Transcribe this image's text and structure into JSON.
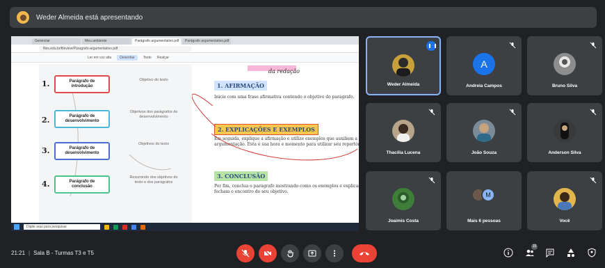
{
  "presenter_banner": {
    "text": "Weder Almeida está apresentando"
  },
  "shared_screen": {
    "browser_tabs": [
      "Gerenciar",
      "Meu ambiente",
      "Parágrafo argumentativo.pdf",
      "Parágrafo argumentativo.pdf"
    ],
    "url": "files.edu.br/fileview/Paragrafo-argumentativo.pdf",
    "toolbar": {
      "draw": "Desenhar",
      "read": "Ler em voz alta",
      "text": "Texto",
      "highlight": "Realçar"
    },
    "mind_map": [
      {
        "num": "1.",
        "label": "Parágrafo de introdução",
        "note": "Objetivo do texto",
        "color": "#e04a4a"
      },
      {
        "num": "2.",
        "label": "Parágrafo de desenvolvimento",
        "note": "Objetivos dos parágrafos de desenvolvimento",
        "color": "#4ab8d8"
      },
      {
        "num": "3.",
        "label": "Parágrafo de desenvolvimento",
        "note": "Objetivos do texto",
        "color": "#4a6ed8"
      },
      {
        "num": "4.",
        "label": "Parágrafo de conclusão",
        "note": "Resumindo dos objetivos do texto e dos parágrafos",
        "color": "#4ac48a"
      }
    ],
    "handwriting": "da redação",
    "sections": [
      {
        "title": "1. AFIRMAÇÃO",
        "body": "Inicie com uma frase afirmativa contendo o objetivo do parágrafo."
      },
      {
        "title": "2. EXPLICAÇÕES E EXEMPLOS",
        "body": "Em seguida, explique a afirmação e utilize exemplos que auxiliem a sua argumentação. Esta é sua hora e momento para utilizar seu repertório."
      },
      {
        "title": "3. CONCLUSÃO",
        "body": "Por fim, conclua o parágrafo mostrando como os exemplos e explicações fecham o encontro do seu objetivo."
      }
    ],
    "taskbar_search": "Digite aqui para pesquisar"
  },
  "participants": [
    {
      "name": "Weder Almeida",
      "type": "photo",
      "color": "#c9a13b",
      "active": true,
      "speaking": true
    },
    {
      "name": "Andreia Campos",
      "type": "letter",
      "letter": "A",
      "active": false
    },
    {
      "name": "Bruno Silva",
      "type": "photo",
      "color": "#8d8d8d",
      "active": false
    },
    {
      "name": "Thacília Lucena",
      "type": "photo",
      "color": "#b8a48a",
      "active": false
    },
    {
      "name": "João Souza",
      "type": "photo",
      "color": "#7a8c9a",
      "active": false
    },
    {
      "name": "Anderson Silva",
      "type": "photo",
      "color": "#3a3a3a",
      "active": false
    },
    {
      "name": "Joaimis Costa",
      "type": "photo",
      "color": "#3f7d3a",
      "active": false
    },
    {
      "name": "Mais 6 pessoas",
      "type": "group",
      "active": false
    },
    {
      "name": "Você",
      "type": "photo",
      "color": "#e2b64d",
      "active": false
    }
  ],
  "bottom_bar": {
    "time": "21:21",
    "meeting_name": "Sala B - Turmas T3 e T5",
    "people_count": "15"
  },
  "colors": {
    "background": "#202124",
    "tile": "#3c4043",
    "danger": "#ea4335",
    "accent": "#8ab4f8"
  }
}
